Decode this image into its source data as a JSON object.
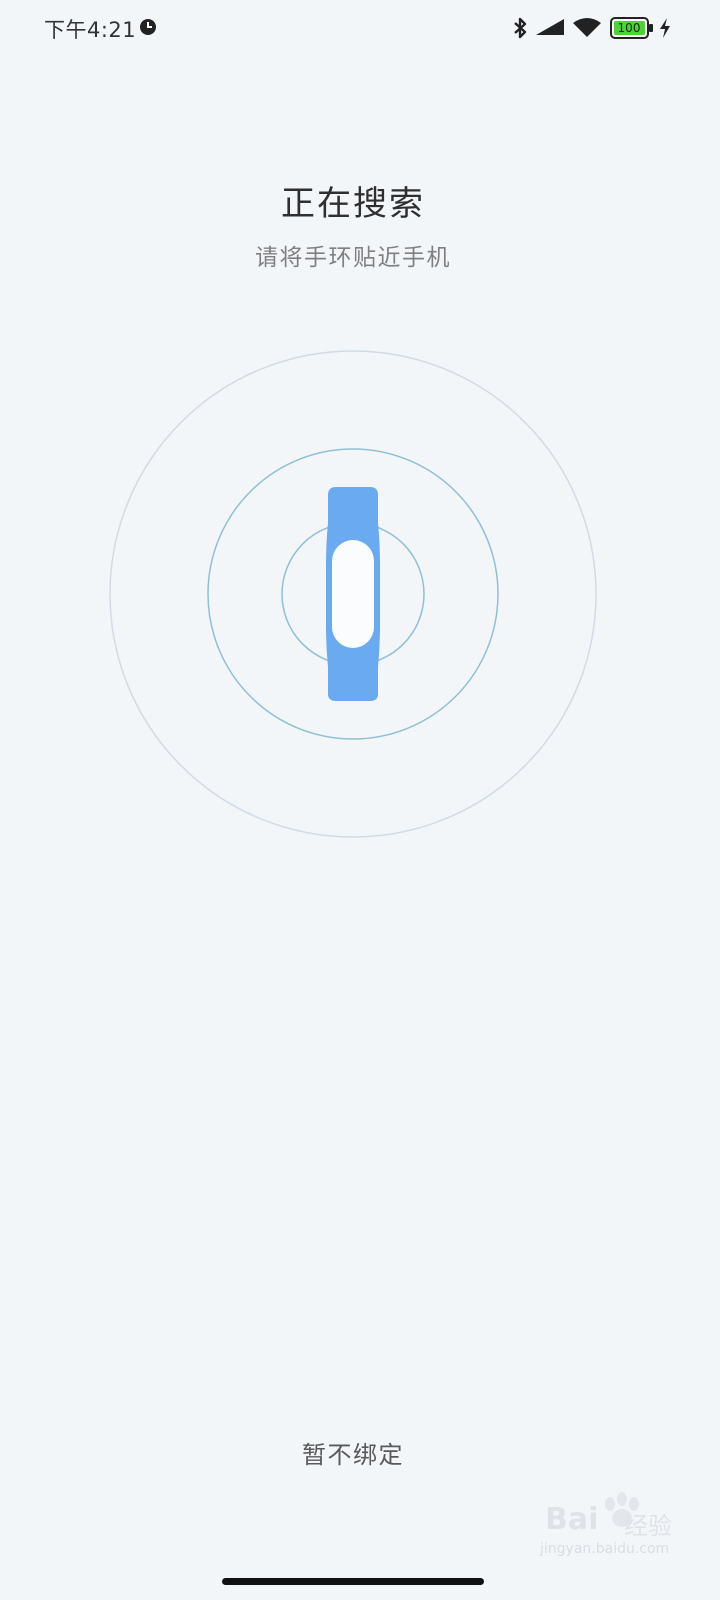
{
  "status_bar": {
    "time": "下午4:21",
    "battery_level": "100",
    "icons": [
      "alarm-icon",
      "bluetooth-icon",
      "signal-icon",
      "wifi-icon",
      "battery-icon",
      "charging-icon"
    ]
  },
  "search": {
    "title": "正在搜索",
    "subtitle": "请将手环贴近手机"
  },
  "illustration": {
    "device": "band-icon",
    "band_color": "#6aaaf0",
    "ring_color": "#8fbfd6"
  },
  "actions": {
    "skip_label": "暂不绑定"
  },
  "watermark": {
    "brand": "Bai",
    "brand_cn": "经验",
    "url": "jingyan.baidu.com"
  }
}
